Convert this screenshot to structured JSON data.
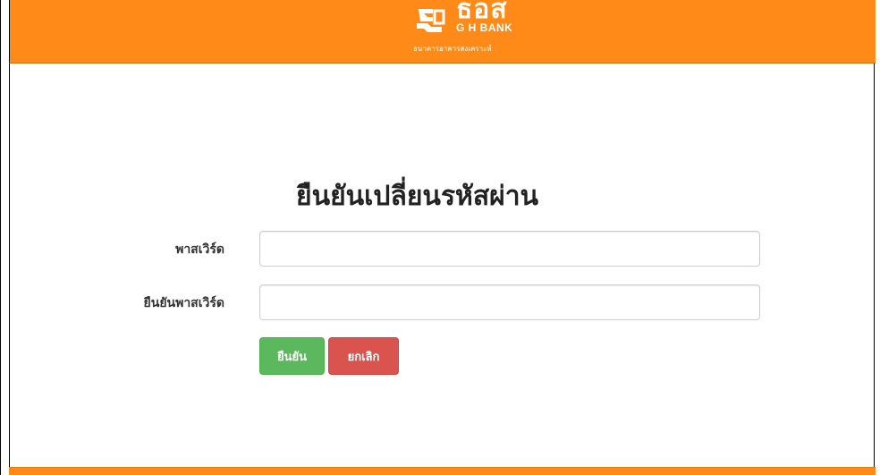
{
  "header": {
    "logo_thai": "ธอส",
    "logo_en": "G H BANK",
    "logo_subtitle": "ธนาคารอาคารสงเคราะห์",
    "brand_color": "#ff8a17"
  },
  "form": {
    "title": "ยืนยันเปลี่ยนรหัสผ่าน",
    "password_label": "พาสเวิร์ด",
    "password_value": "",
    "confirm_password_label": "ยืนยันพาสเวิร์ด",
    "confirm_password_value": "",
    "confirm_button": "ยืนยัน",
    "cancel_button": "ยกเลิก"
  },
  "colors": {
    "confirm": "#5cb85c",
    "cancel": "#d9534f"
  }
}
